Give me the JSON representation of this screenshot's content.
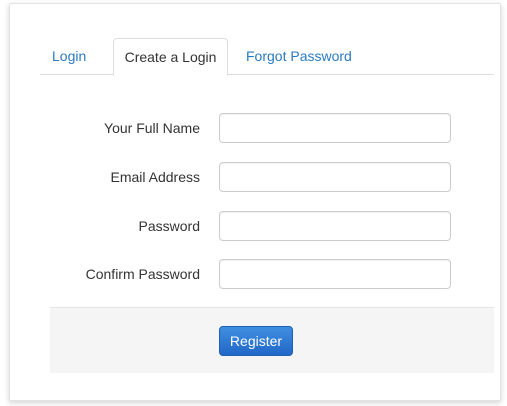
{
  "tabs": [
    {
      "label": "Login",
      "active": false
    },
    {
      "label": "Create a Login",
      "active": true
    },
    {
      "label": "Forgot Password",
      "active": false
    }
  ],
  "form": {
    "full_name": {
      "label": "Your Full Name",
      "value": ""
    },
    "email": {
      "label": "Email Address",
      "value": ""
    },
    "password": {
      "label": "Password",
      "value": ""
    },
    "confirm_password": {
      "label": "Confirm Password",
      "value": ""
    }
  },
  "actions": {
    "register_label": "Register"
  },
  "colors": {
    "link": "#2a7ac0",
    "button": "#2167c8",
    "footer_bg": "#f5f5f5"
  }
}
